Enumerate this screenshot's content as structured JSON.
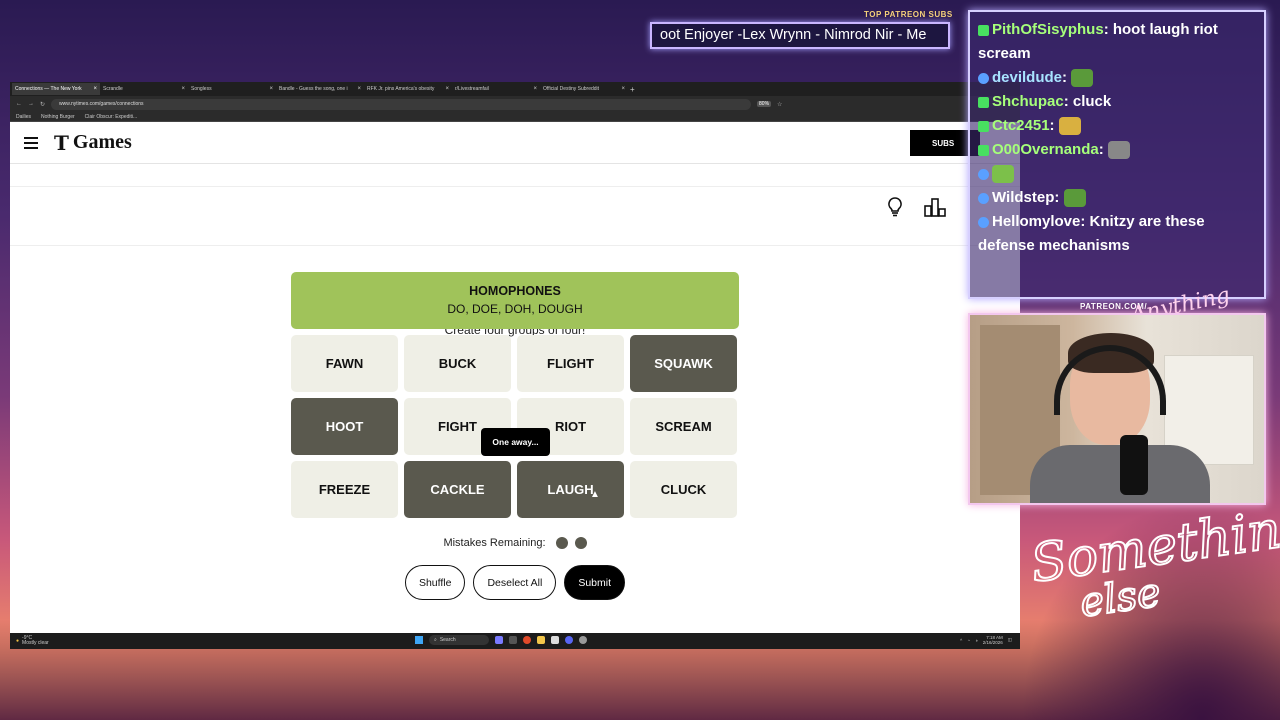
{
  "stream": {
    "top_patreon_label": "TOP PATREON SUBS",
    "ticker_text": "oot Enjoyer -Lex Wrynn - Nimrod Nir - Me",
    "patreon_url_label": "PATREON.COM/",
    "patreon_scribble": "Anything else",
    "signature_line1": "Something",
    "signature_line2": "else"
  },
  "browser": {
    "tabs": [
      {
        "label": "Connections — The New York",
        "active": true
      },
      {
        "label": "Scrandle",
        "active": false
      },
      {
        "label": "Songless",
        "active": false
      },
      {
        "label": "Bandle - Guess the song, one i",
        "active": false
      },
      {
        "label": "RFK Jr. pins America's obesity",
        "active": false
      },
      {
        "label": "r/Livestreamfail",
        "active": false
      },
      {
        "label": "Official Destiny Subreddit",
        "active": false
      }
    ],
    "url": "www.nytimes.com/games/connections",
    "zoom": "80%",
    "bookmarks": [
      "Dailies",
      "Nothing Burger",
      "Clair Obscur: Expediti..."
    ]
  },
  "nyt": {
    "logo_t": "T",
    "logo_text": "Games",
    "subscribe_label": "SUBS"
  },
  "game": {
    "instructions": "Create four groups of four!",
    "solved": [
      {
        "category": "HOMOPHONES",
        "words": "DO, DOE, DOH, DOUGH",
        "color": "#a0c35a"
      }
    ],
    "tiles": [
      {
        "word": "FAWN",
        "selected": false
      },
      {
        "word": "BUCK",
        "selected": false
      },
      {
        "word": "FLIGHT",
        "selected": false
      },
      {
        "word": "SQUAWK",
        "selected": true
      },
      {
        "word": "HOOT",
        "selected": true
      },
      {
        "word": "FIGHT",
        "selected": false
      },
      {
        "word": "RIOT",
        "selected": false
      },
      {
        "word": "SCREAM",
        "selected": false
      },
      {
        "word": "FREEZE",
        "selected": false
      },
      {
        "word": "CACKLE",
        "selected": true
      },
      {
        "word": "LAUGH",
        "selected": true
      },
      {
        "word": "CLUCK",
        "selected": false
      }
    ],
    "toast": "One away...",
    "mistakes_label": "Mistakes Remaining:",
    "mistakes_remaining": 2,
    "buttons": {
      "shuffle": "Shuffle",
      "deselect": "Deselect All",
      "submit": "Submit"
    }
  },
  "taskbar": {
    "temp": "-9°C",
    "weather": "Mostly clear",
    "search": "Search",
    "time": "7:18 AM",
    "date": "2/16/2026"
  },
  "chat": {
    "messages": [
      {
        "user": "PithOfSisyphus",
        "text": "hoot laugh riot scream",
        "color": "green"
      },
      {
        "user": "devildude",
        "text": "",
        "color": "cyan"
      },
      {
        "user": "Shchupac",
        "text": "cluck",
        "color": "green"
      },
      {
        "user": "Ctc2451",
        "text": "",
        "color": "green"
      },
      {
        "user": "O00Overnanda",
        "text": "",
        "color": "green"
      },
      {
        "user": "",
        "text": "",
        "color": "white"
      },
      {
        "user": "Wildstep",
        "text": "",
        "color": "white"
      },
      {
        "user": "Hellomylove",
        "text": "Knitzy are these defense mechanisms",
        "color": "white"
      }
    ]
  }
}
